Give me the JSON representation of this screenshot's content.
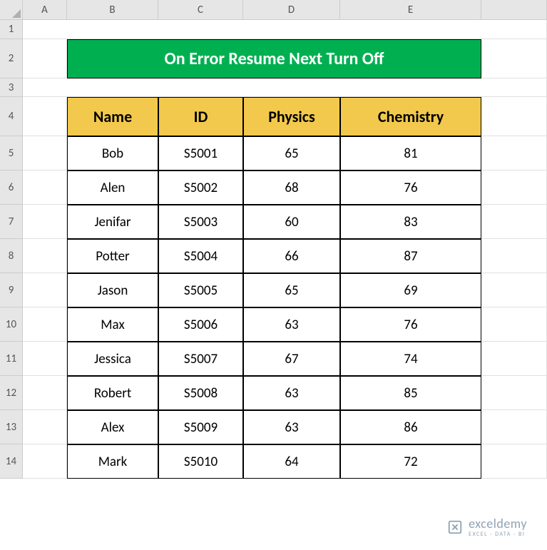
{
  "columns": [
    "A",
    "B",
    "C",
    "D",
    "E"
  ],
  "rows": [
    "1",
    "2",
    "3",
    "4",
    "5",
    "6",
    "7",
    "8",
    "9",
    "10",
    "11",
    "12",
    "13",
    "14"
  ],
  "title": "On Error Resume Next Turn Off",
  "headers": {
    "name": "Name",
    "id": "ID",
    "physics": "Physics",
    "chemistry": "Chemistry"
  },
  "data": [
    {
      "name": "Bob",
      "id": "S5001",
      "physics": "65",
      "chemistry": "81"
    },
    {
      "name": "Alen",
      "id": "S5002",
      "physics": "68",
      "chemistry": "76"
    },
    {
      "name": "Jenifar",
      "id": "S5003",
      "physics": "60",
      "chemistry": "83"
    },
    {
      "name": "Potter",
      "id": "S5004",
      "physics": "66",
      "chemistry": "87"
    },
    {
      "name": "Jason",
      "id": "S5005",
      "physics": "65",
      "chemistry": "69"
    },
    {
      "name": "Max",
      "id": "S5006",
      "physics": "63",
      "chemistry": "76"
    },
    {
      "name": "Jessica",
      "id": "S5007",
      "physics": "67",
      "chemistry": "74"
    },
    {
      "name": "Robert",
      "id": "S5008",
      "physics": "63",
      "chemistry": "85"
    },
    {
      "name": "Alex",
      "id": "S5009",
      "physics": "63",
      "chemistry": "86"
    },
    {
      "name": "Mark",
      "id": "S5010",
      "physics": "64",
      "chemistry": "72"
    }
  ],
  "watermark": {
    "main": "exceldemy",
    "sub": "EXCEL · DATA · BI"
  },
  "chart_data": {
    "type": "table",
    "title": "On Error Resume Next Turn Off",
    "columns": [
      "Name",
      "ID",
      "Physics",
      "Chemistry"
    ],
    "rows": [
      [
        "Bob",
        "S5001",
        65,
        81
      ],
      [
        "Alen",
        "S5002",
        68,
        76
      ],
      [
        "Jenifar",
        "S5003",
        60,
        83
      ],
      [
        "Potter",
        "S5004",
        66,
        87
      ],
      [
        "Jason",
        "S5005",
        65,
        69
      ],
      [
        "Max",
        "S5006",
        63,
        76
      ],
      [
        "Jessica",
        "S5007",
        67,
        74
      ],
      [
        "Robert",
        "S5008",
        63,
        85
      ],
      [
        "Alex",
        "S5009",
        63,
        86
      ],
      [
        "Mark",
        "S5010",
        64,
        72
      ]
    ]
  }
}
